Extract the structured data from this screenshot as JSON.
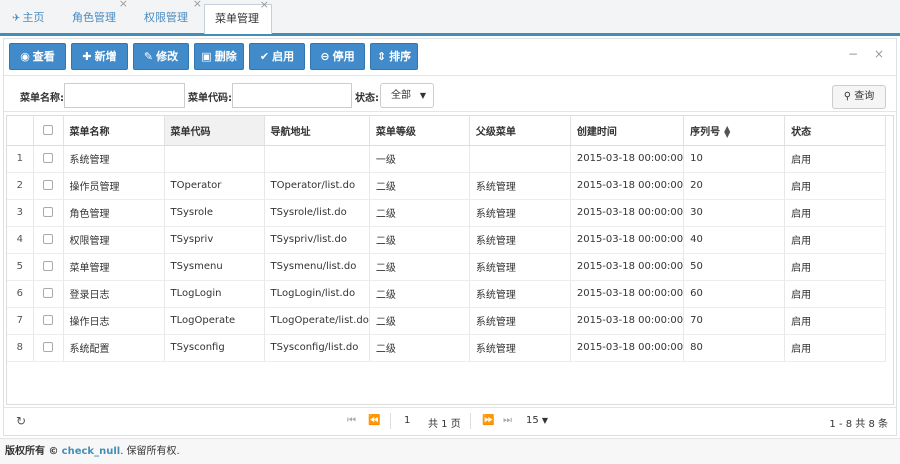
{
  "tabs": [
    {
      "label": "主页",
      "close": ""
    },
    {
      "label": "角色管理",
      "close": "×"
    },
    {
      "label": "权限管理",
      "close": "×"
    },
    {
      "label": "菜单管理",
      "close": "×"
    }
  ],
  "toolbar": {
    "view": "查看",
    "add": "新增",
    "edit": "修改",
    "delete": "删除",
    "enable": "启用",
    "disable": "停用",
    "sort": "排序",
    "minimize": "−",
    "close": "×"
  },
  "search": {
    "name_label": "菜单名称:",
    "name_value": "",
    "code_label": "菜单代码:",
    "code_value": "",
    "status_label": "状态:",
    "status_value": "全部",
    "query_button": "查询"
  },
  "table": {
    "headers": [
      "菜单名称",
      "菜单代码",
      "导航地址",
      "菜单等级",
      "父级菜单",
      "创建时间",
      "序列号",
      "状态"
    ],
    "rows": [
      [
        "1",
        "系统管理",
        "",
        "",
        "一级",
        "",
        "2015-03-18 00:00:00",
        "10",
        "启用"
      ],
      [
        "2",
        "操作员管理",
        "TOperator",
        "TOperator/list.do",
        "二级",
        "系统管理",
        "2015-03-18 00:00:00",
        "20",
        "启用"
      ],
      [
        "3",
        "角色管理",
        "TSysrole",
        "TSysrole/list.do",
        "二级",
        "系统管理",
        "2015-03-18 00:00:00",
        "30",
        "启用"
      ],
      [
        "4",
        "权限管理",
        "TSyspriv",
        "TSyspriv/list.do",
        "二级",
        "系统管理",
        "2015-03-18 00:00:00",
        "40",
        "启用"
      ],
      [
        "5",
        "菜单管理",
        "TSysmenu",
        "TSysmenu/list.do",
        "二级",
        "系统管理",
        "2015-03-18 00:00:00",
        "50",
        "启用"
      ],
      [
        "6",
        "登录日志",
        "TLogLogin",
        "TLogLogin/list.do",
        "二级",
        "系统管理",
        "2015-03-18 00:00:00",
        "60",
        "启用"
      ],
      [
        "7",
        "操作日志",
        "TLogOperate",
        "TLogOperate/list.do",
        "二级",
        "系统管理",
        "2015-03-18 00:00:00",
        "70",
        "启用"
      ],
      [
        "8",
        "系统配置",
        "TSysconfig",
        "TSysconfig/list.do",
        "二级",
        "系统管理",
        "2015-03-18 00:00:00",
        "80",
        "启用"
      ]
    ]
  },
  "pager": {
    "page": "1",
    "total_pages": "共 1 页",
    "page_size": "15",
    "range": "1 - 8  共 8 条"
  },
  "footer": {
    "prefix": "版权所有 ©",
    "brand": "check_null",
    "suffix": ". 保留所有权."
  },
  "colors": {
    "primary": "#428bca",
    "tab_link": "#4a8bc2",
    "accent_border": "#438eb9"
  }
}
